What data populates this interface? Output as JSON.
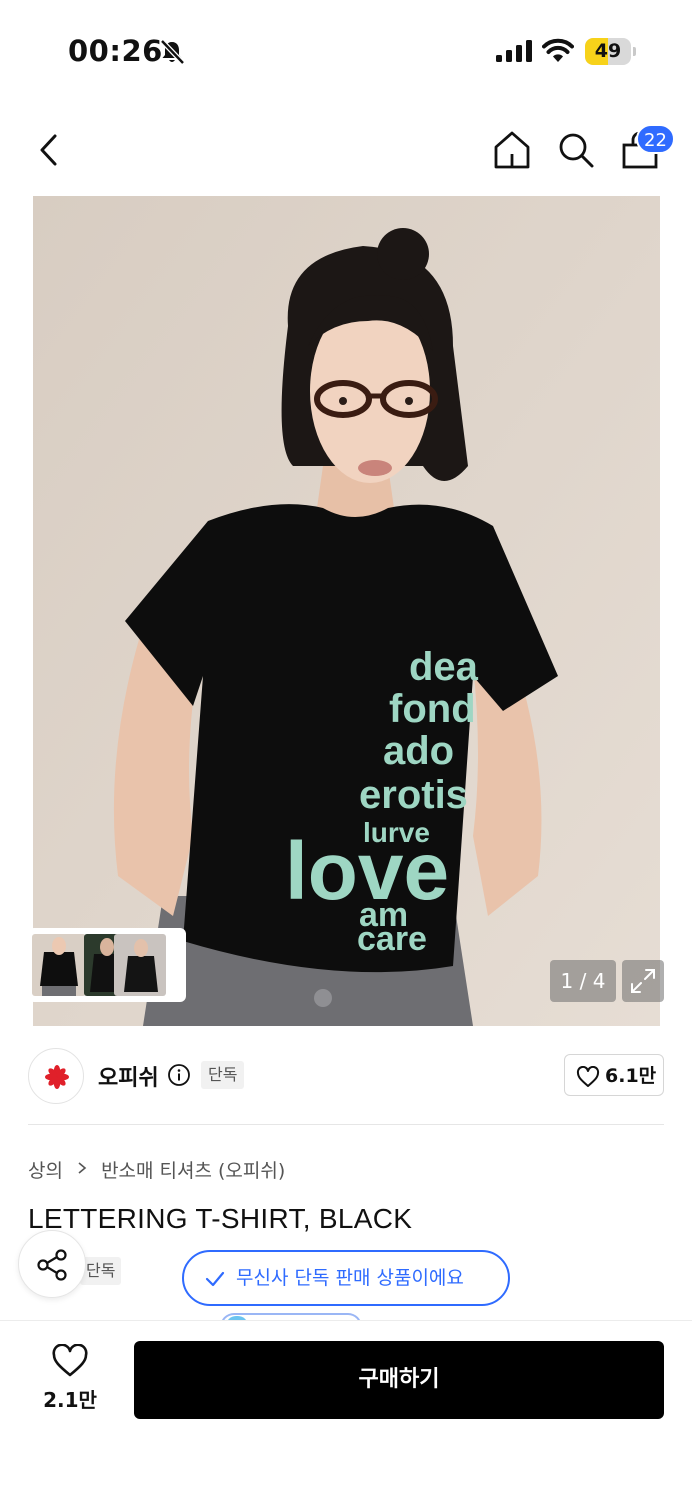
{
  "status_bar": {
    "time": "00:26",
    "battery": "49",
    "battery_level": 0.49
  },
  "nav": {
    "cart_count": "22"
  },
  "gallery": {
    "shirt_text": [
      "dea",
      "fond",
      "ado",
      "erotis",
      "lurve",
      "love",
      "am",
      "care"
    ],
    "counter": "1 / 4"
  },
  "brand": {
    "name": "오피쉬",
    "tag": "단독",
    "likes": "6.1만"
  },
  "breadcrumb": {
    "category": "상의",
    "subcategory": "반소매 티셔츠 (오피쉬)"
  },
  "product": {
    "title": "LETTERING T-SHIRT, BLACK",
    "tag": "단독"
  },
  "toast": {
    "text": "무신사 단독 판매 상품이에요"
  },
  "bottom_bar": {
    "likes": "2.1만",
    "buy_label": "구매하기"
  },
  "colors": {
    "accent": "#2f6bff",
    "shirt_print": "#9ed6c3",
    "battery_fill": "#f7d21a",
    "brand_logo": "#e0202a"
  }
}
